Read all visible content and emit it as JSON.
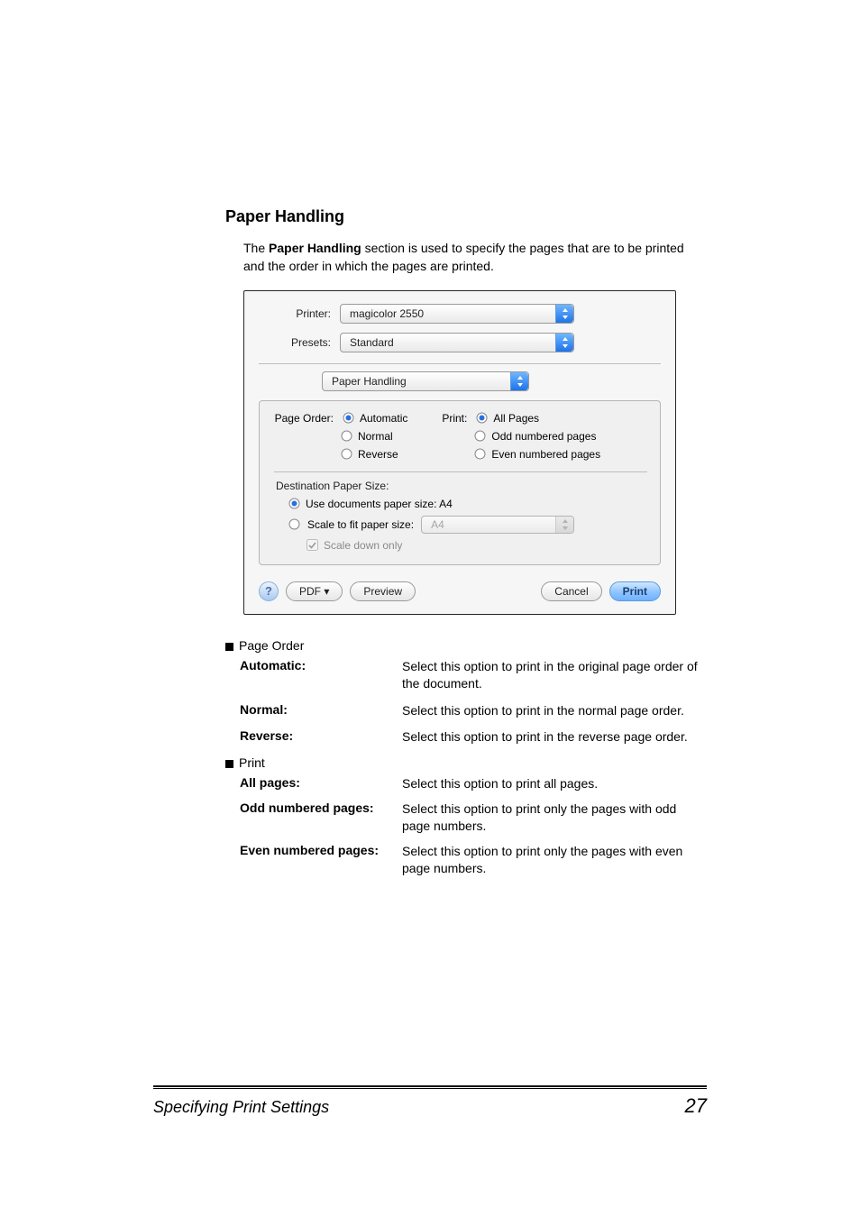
{
  "section": {
    "title": "Paper Handling",
    "intro_pre": "The ",
    "intro_bold": "Paper Handling",
    "intro_post": " section is used to specify the pages that are to be printed and the order in which the pages are printed."
  },
  "dialog": {
    "printer_label": "Printer:",
    "printer_value": "magicolor 2550",
    "presets_label": "Presets:",
    "presets_value": "Standard",
    "pane_value": "Paper Handling",
    "page_order_label": "Page Order:",
    "page_order": {
      "automatic": "Automatic",
      "normal": "Normal",
      "reverse": "Reverse"
    },
    "print_label": "Print:",
    "print": {
      "all": "All Pages",
      "odd": "Odd numbered pages",
      "even": "Even numbered pages"
    },
    "dest_title": "Destination Paper Size:",
    "use_doc_label": "Use documents paper size:  A4",
    "scale_label": "Scale to fit paper size:",
    "scale_value": "A4",
    "scale_down": "Scale down only",
    "help": "?",
    "pdf": "PDF ▾",
    "preview": "Preview",
    "cancel": "Cancel",
    "print_btn": "Print"
  },
  "lists": {
    "page_order_heading": "Page Order",
    "po": [
      {
        "term": "Automatic:",
        "desc": "Select this option to print in the original page order of the document."
      },
      {
        "term": "Normal:",
        "desc": "Select this option to print in the normal page order."
      },
      {
        "term": "Reverse:",
        "desc": "Select this option to print in the reverse page order."
      }
    ],
    "print_heading": "Print",
    "pr": [
      {
        "term": "All pages:",
        "desc": "Select this option to print all pages."
      },
      {
        "term": "Odd numbered pages:",
        "desc": "Select this option to print only the pages with odd page numbers."
      },
      {
        "term": "Even numbered pages:",
        "desc": "Select this option to print only the pages with even page numbers."
      }
    ]
  },
  "footer": {
    "title": "Specifying Print Settings",
    "page": "27"
  }
}
